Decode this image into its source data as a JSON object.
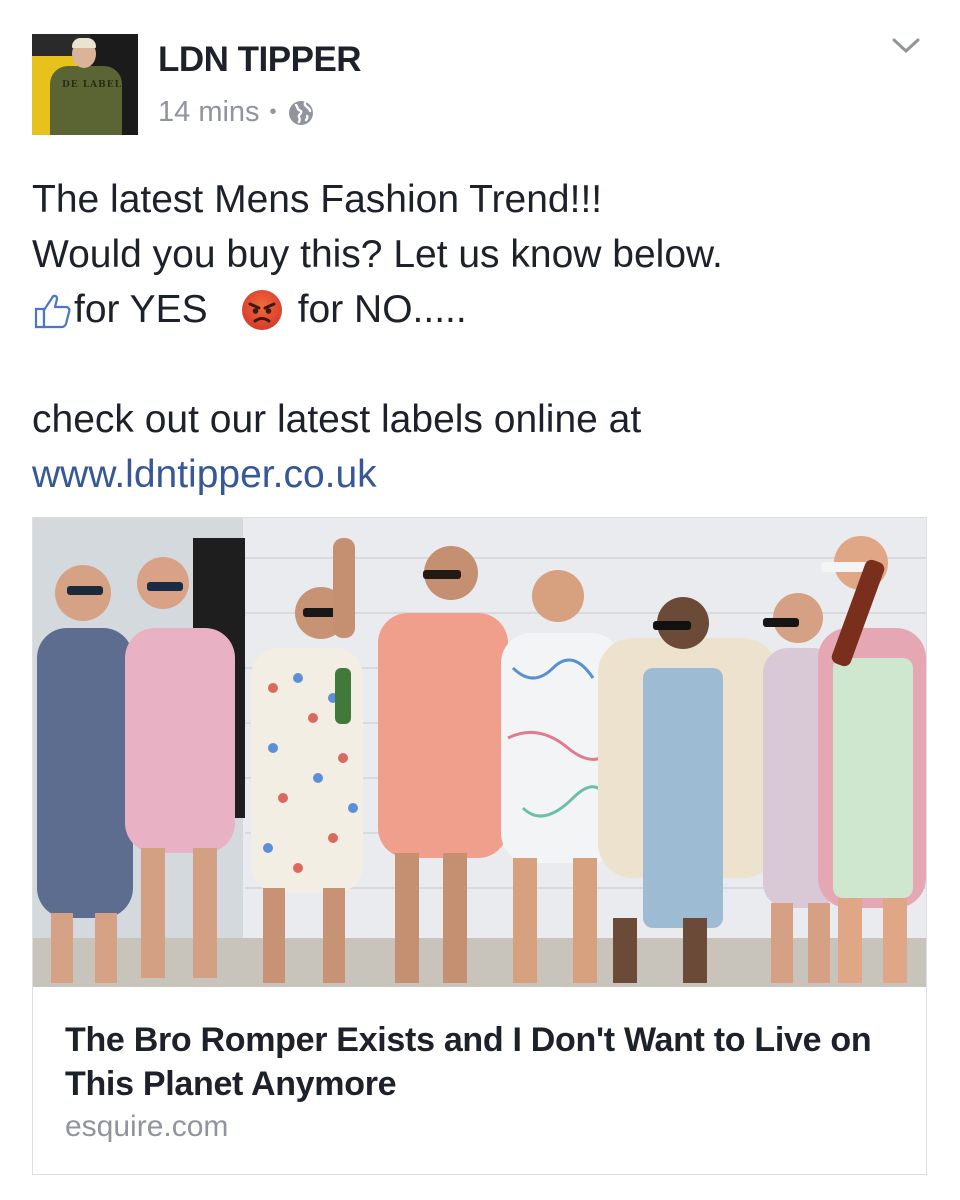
{
  "post": {
    "author": "LDN TIPPER",
    "time": "14 mins",
    "separator": "•",
    "privacy_icon": "globe-icon",
    "options_icon": "chevron-down-icon",
    "avatar_text": "DE LABEL",
    "text": {
      "line1": "The latest Mens Fashion Trend!!!",
      "line2": "Would you buy this? Let us know below.",
      "yes_label": "for YES",
      "no_label": "for NO.....",
      "yes_icon": "thumbs-up-icon",
      "no_icon": "angry-face-icon",
      "line4": "check out our latest labels online at",
      "url": "www.ldntipper.co.uk"
    }
  },
  "link_card": {
    "title": "The Bro Romper Exists and I Don't Want to Live on This Planet Anymore",
    "domain": "esquire.com"
  },
  "colors": {
    "text": "#1d2129",
    "meta": "#90949c",
    "link": "#365899",
    "border": "#dddfe2"
  }
}
